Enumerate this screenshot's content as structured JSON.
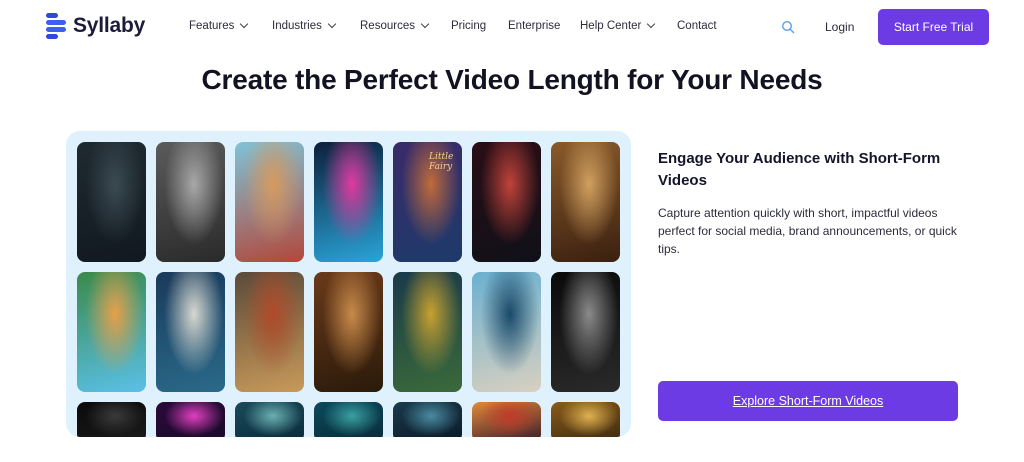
{
  "brand": {
    "name": "Syllaby",
    "color": "#2f49d8"
  },
  "nav": {
    "items": [
      {
        "label": "Features",
        "dropdown": true
      },
      {
        "label": "Industries",
        "dropdown": true
      },
      {
        "label": "Resources",
        "dropdown": true
      },
      {
        "label": "Pricing",
        "dropdown": false
      },
      {
        "label": "Enterprise",
        "dropdown": false
      },
      {
        "label": "Help Center",
        "dropdown": true
      },
      {
        "label": "Contact",
        "dropdown": false
      }
    ],
    "search_icon": "search-icon",
    "login_label": "Login",
    "cta_label": "Start Free Trial"
  },
  "page": {
    "title": "Create the Perfect Video Length for Your Needs"
  },
  "gallery": {
    "background": "#dff1fc",
    "thumbnails": [
      {
        "name": "soldiers-thumbnail",
        "colors": [
          "#1f2a30",
          "#3b4a52",
          "#111820"
        ]
      },
      {
        "name": "street-photographer-thumbnail",
        "colors": [
          "#5b5b5b",
          "#a8a8a8",
          "#2a2a2a"
        ]
      },
      {
        "name": "vintage-cars-street-thumbnail",
        "colors": [
          "#7fc3d8",
          "#d69a5e",
          "#b2473a"
        ]
      },
      {
        "name": "vr-headset-thumbnail",
        "colors": [
          "#0c1f3a",
          "#e03aa0",
          "#2aa4d8"
        ]
      },
      {
        "name": "little-fairy-thumbnail",
        "colors": [
          "#3a2a6a",
          "#c06a3a",
          "#1d3a6a"
        ],
        "caption": "Little Fairy"
      },
      {
        "name": "red-moon-thumbnail",
        "colors": [
          "#2a0e16",
          "#c0433a",
          "#101018"
        ]
      },
      {
        "name": "desert-warriors-thumbnail",
        "colors": [
          "#8a5a2a",
          "#d0a060",
          "#3a2010"
        ]
      },
      {
        "name": "cottage-village-thumbnail",
        "colors": [
          "#3a8a4a",
          "#e6a04a",
          "#5ac0e8"
        ]
      },
      {
        "name": "scientist-thumbnail",
        "colors": [
          "#1a3a5a",
          "#d8d8d0",
          "#2a6a8a"
        ]
      },
      {
        "name": "hero-lion-thumbnail",
        "colors": [
          "#5a4a3a",
          "#b04a2a",
          "#c89a5a"
        ]
      },
      {
        "name": "eye-closeup-thumbnail",
        "colors": [
          "#6a3a1a",
          "#c88a4a",
          "#2a1a0a"
        ]
      },
      {
        "name": "young-wizard-thumbnail",
        "colors": [
          "#1a3a4a",
          "#c8a030",
          "#3a6a3a"
        ]
      },
      {
        "name": "lighthouse-thumbnail",
        "colors": [
          "#6ab0d0",
          "#1a4a6a",
          "#d8d0c0"
        ]
      },
      {
        "name": "woman-profile-thumbnail",
        "colors": [
          "#0a0a0a",
          "#8a8a8a",
          "#2a2a2a"
        ]
      },
      {
        "name": "dark-figure-thumbnail",
        "colors": [
          "#0a0a0a",
          "#3a3a3a",
          "#1a1a1a"
        ]
      },
      {
        "name": "neon-sunset-thumbnail",
        "colors": [
          "#2a0a3a",
          "#e040c0",
          "#1a0a2a"
        ]
      },
      {
        "name": "moonlit-horse-thumbnail",
        "colors": [
          "#1a4a5a",
          "#6ab0b0",
          "#0a2a3a"
        ]
      },
      {
        "name": "underwater-thumbnail",
        "colors": [
          "#0a4a5a",
          "#3aa0a0",
          "#0a2a3a"
        ]
      },
      {
        "name": "dark-forest-thumbnail",
        "colors": [
          "#1a3a4a",
          "#4a8aa0",
          "#0a1a2a"
        ]
      },
      {
        "name": "castle-sunset-thumbnail",
        "colors": [
          "#e08a3a",
          "#c03a2a",
          "#3a1a2a"
        ]
      },
      {
        "name": "grand-hall-thumbnail",
        "colors": [
          "#8a5a1a",
          "#e0b050",
          "#3a2a10"
        ]
      }
    ]
  },
  "section": {
    "heading": "Engage Your Audience with Short-Form Videos",
    "description": "Capture attention quickly with short, impactful videos perfect for social media, brand announcements, or quick tips.",
    "button_label": "Explore Short-Form Videos"
  },
  "colors": {
    "accent": "#6d3be3",
    "text": "#15152a"
  }
}
